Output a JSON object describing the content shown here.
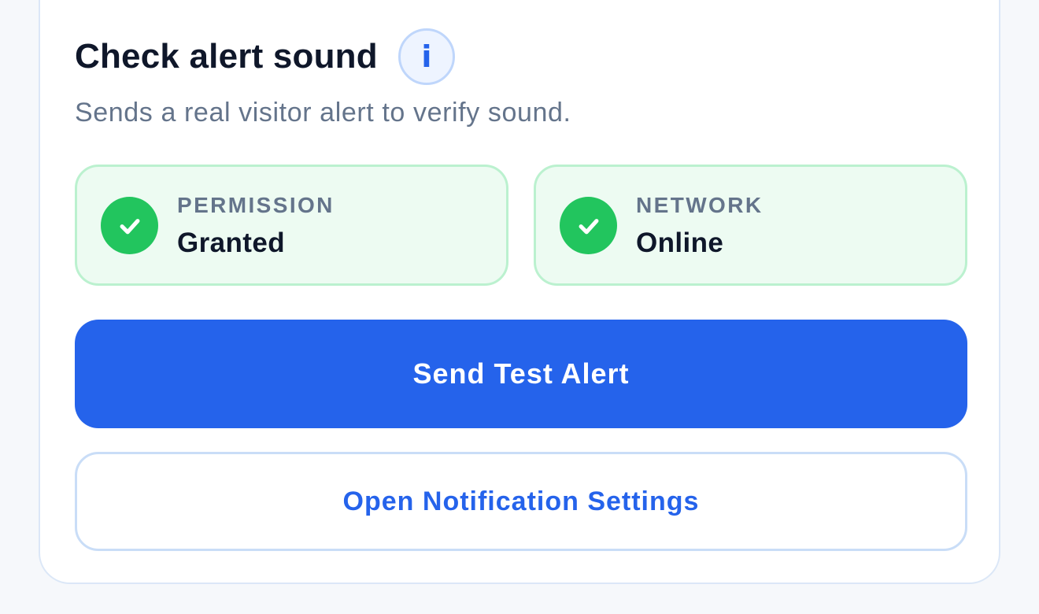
{
  "card": {
    "title": "Check alert sound",
    "info_icon": "info-icon",
    "info_glyph": "i",
    "subtitle": "Sends a real visitor alert to verify sound."
  },
  "status": [
    {
      "label": "PERMISSION",
      "value": "Granted",
      "icon": "check-circle-icon",
      "state": "ok"
    },
    {
      "label": "NETWORK",
      "value": "Online",
      "icon": "check-circle-icon",
      "state": "ok"
    }
  ],
  "actions": {
    "primary_label": "Send Test Alert",
    "secondary_label": "Open Notification Settings"
  },
  "colors": {
    "accent": "#2563eb",
    "success": "#22c55e",
    "success_bg": "#edfbf2",
    "title_text": "#0f172a",
    "muted_text": "#64748b"
  }
}
